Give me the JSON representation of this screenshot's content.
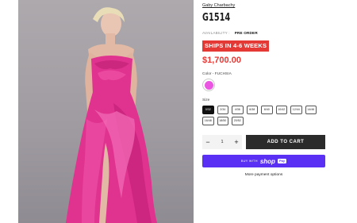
{
  "product": {
    "brand": "Gaby Charbachy",
    "title": "G1514",
    "availability_label": "AVAILABILITY :",
    "availability_value": "PRE ORDER",
    "shipping_badge": "SHIPS IN 4-6 WEEKS",
    "price": "$1,700.00",
    "color_label": "Color - FUCHSIA",
    "color_swatch": "#ea55e2",
    "size_label": "Size",
    "sizes": [
      "0/32",
      "2/34",
      "4/36",
      "6/38",
      "8/40",
      "10/42",
      "12/44",
      "14/46",
      "16/48",
      "18/50",
      "20/52"
    ],
    "selected_size": "0/32"
  },
  "cart": {
    "minus": "−",
    "quantity": "1",
    "plus": "+",
    "add_to_cart": "ADD TO CART"
  },
  "payment": {
    "buy_with": "BUY WITH",
    "shop": "shop",
    "pay": "Pay",
    "more_options": "More payment options",
    "brand_color": "#5a31f4"
  },
  "colors": {
    "accent_red": "#e53935",
    "button_dark": "#2b2b2b",
    "dress": "#e0338f"
  }
}
